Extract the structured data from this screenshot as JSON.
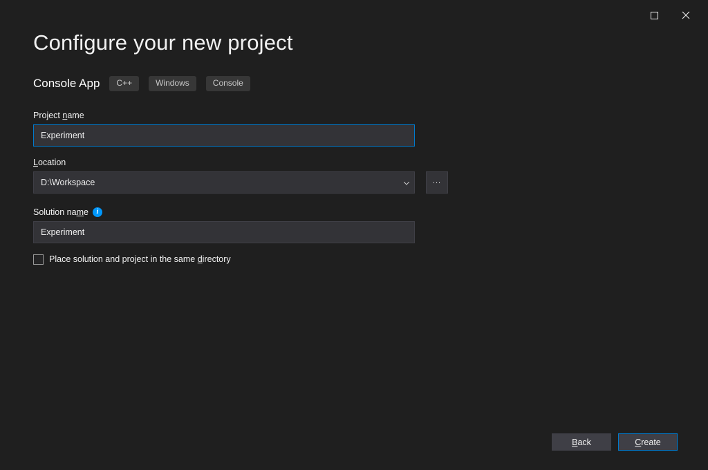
{
  "titlebar": {
    "maximize_icon": "maximize",
    "close_icon": "close"
  },
  "header": {
    "title": "Configure your new project",
    "project_type": "Console App",
    "tags": [
      "C++",
      "Windows",
      "Console"
    ]
  },
  "fields": {
    "project_name": {
      "label_pre": "Project ",
      "label_u": "n",
      "label_post": "ame",
      "value": "Experiment"
    },
    "location": {
      "label_u": "L",
      "label_post": "ocation",
      "value": "D:\\Workspace",
      "browse_label": "..."
    },
    "solution_name": {
      "label_pre": "Solution na",
      "label_u": "m",
      "label_post": "e",
      "value": "Experiment"
    },
    "same_dir": {
      "label_pre": "Place solution and project in the same ",
      "label_u": "d",
      "label_post": "irectory"
    }
  },
  "footer": {
    "back_u": "B",
    "back_post": "ack",
    "create_u": "C",
    "create_post": "reate"
  }
}
